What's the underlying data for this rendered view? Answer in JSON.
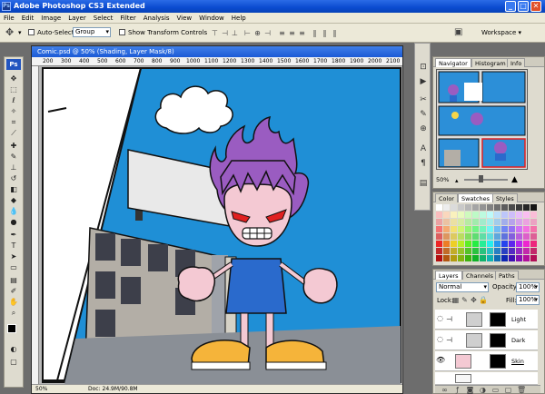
{
  "app": {
    "title": "Adobe Photoshop CS3 Extended",
    "logo_text": "Ps",
    "window_buttons": [
      "_",
      "□",
      "✕"
    ]
  },
  "menu": [
    "File",
    "Edit",
    "Image",
    "Layer",
    "Select",
    "Filter",
    "Analysis",
    "View",
    "Window",
    "Help"
  ],
  "options": {
    "auto_select_label": "Auto-Select:",
    "auto_select_value": "Group",
    "transform_label": "Show Transform Controls",
    "workspace_label": "Workspace ▾"
  },
  "document": {
    "title": "Comic.psd @ 50% (Shading, Layer Mask/8)",
    "ruler_ticks": [
      "200",
      "300",
      "400",
      "500",
      "600",
      "700",
      "800",
      "900",
      "1000",
      "1100",
      "1200",
      "1300",
      "1400",
      "1500",
      "1600",
      "1700",
      "1800",
      "1900",
      "2000",
      "2100"
    ],
    "zoom": "50%",
    "doc_size": "Doc: 24.9M/90.8M"
  },
  "navigator": {
    "tabs": [
      "Navigator",
      "Histogram",
      "Info"
    ],
    "zoom": "50%"
  },
  "color_panel": {
    "tabs": [
      "Color",
      "Swatches",
      "Styles"
    ]
  },
  "layers_panel": {
    "tabs": [
      "Layers",
      "Channels",
      "Paths"
    ],
    "blend_mode": "Normal",
    "opacity_label": "Opacity:",
    "opacity_value": "100%",
    "lock_label": "Lock:",
    "fill_label": "Fill:",
    "fill_value": "100%",
    "layers": [
      {
        "name": "Light",
        "selected": false
      },
      {
        "name": "Dark",
        "selected": false
      },
      {
        "name": "Skin",
        "selected": false
      }
    ]
  },
  "colors": {
    "sky": "#1f8fd6",
    "hair": "#9a5cc1",
    "shirt": "#2a6acc",
    "shoe": "#f5b43a",
    "skin": "#f4c9d3",
    "building": "#b3aea6",
    "street": "#8a8f96"
  }
}
